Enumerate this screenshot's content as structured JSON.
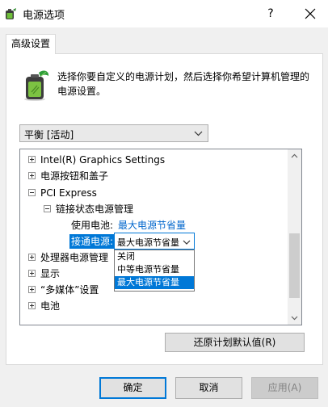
{
  "window": {
    "title": "电源选项",
    "help_glyph": "?",
    "icon": "power-options-icon"
  },
  "tab": {
    "label": "高级设置"
  },
  "description": "选择你要自定义的电源计划，然后选择你希望计算机管理的电源设置。",
  "plan_select": {
    "value": "平衡 [活动]"
  },
  "tree": {
    "items": [
      {
        "label": "Intel(R) Graphics Settings",
        "state": "collapsed"
      },
      {
        "label": "电源按钮和盖子",
        "state": "collapsed"
      },
      {
        "label": "PCI Express",
        "state": "expanded"
      },
      {
        "label": "链接状态电源管理",
        "state": "expanded"
      },
      {
        "label": "使用电池:",
        "value": "最大电源节省量"
      },
      {
        "label": "接通电源:",
        "value": "最大电源节省量"
      },
      {
        "label": "处理器电源管理",
        "state": "collapsed"
      },
      {
        "label": "显示",
        "state": "collapsed"
      },
      {
        "label": "“多媒体”设置",
        "state": "collapsed"
      },
      {
        "label": "电池",
        "state": "collapsed"
      }
    ]
  },
  "dropdown": {
    "options": [
      "关闭",
      "中等电源节省量",
      "最大电源节省量"
    ],
    "selected": "最大电源节省量"
  },
  "buttons": {
    "restore": "还原计划默认值(R)",
    "ok": "确定",
    "cancel": "取消",
    "apply": "应用(A)"
  },
  "colors": {
    "accent": "#0078d7",
    "link_value": "#0066cc",
    "window_bg": "#f0f0f0"
  }
}
